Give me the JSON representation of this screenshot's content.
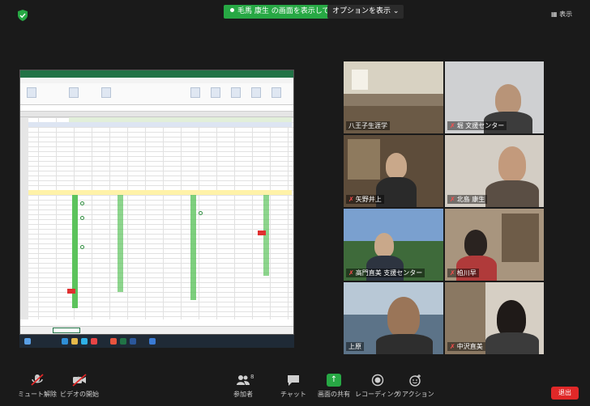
{
  "topbar": {
    "sharing_text": "毛馬 康生 の画面を表示しています",
    "options_label": "オプションを表示",
    "options_caret": "⌄",
    "view_label": "表示"
  },
  "participants": [
    {
      "name": "八王子生涯学"
    },
    {
      "name": "堀 文援センター"
    },
    {
      "name": "矢野井上"
    },
    {
      "name": "北島 康生"
    },
    {
      "name": "高門直美 支援センター"
    },
    {
      "name": "柏川早"
    },
    {
      "name": "上原"
    },
    {
      "name": "中沢直美"
    }
  ],
  "toolbar": {
    "mute_label": "ミュート解除",
    "video_label": "ビデオの開始",
    "participants_label": "参加者",
    "participants_count": "8",
    "chat_label": "チャット",
    "share_label": "画面の共有",
    "record_label": "レコーディング",
    "reaction_label": "リアクション",
    "leave_label": "退出"
  },
  "colors": {
    "share_green": "#27a844",
    "leave_red": "#e02828",
    "excel_green": "#217346",
    "active_speaker": "#d8e04a"
  }
}
